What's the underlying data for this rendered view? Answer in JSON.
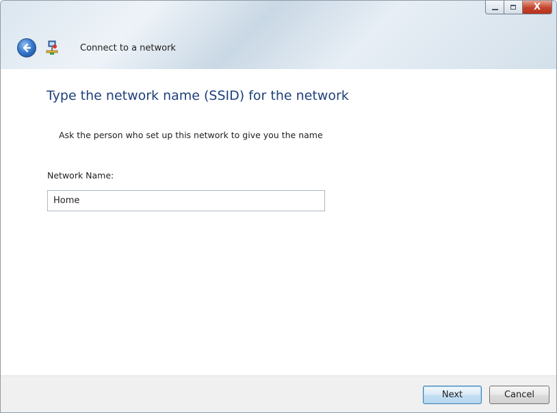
{
  "window": {
    "title": "Connect to a network",
    "controls": {
      "minimize_icon": "minimize-icon",
      "maximize_icon": "maximize-icon",
      "close_icon": "close-icon",
      "close_glyph": "X"
    },
    "back_icon": "back-arrow-icon",
    "app_icon": "network-icon"
  },
  "main": {
    "heading": "Type the network name (SSID) for the network",
    "instruction": "Ask the person who set up this network to give you the name",
    "network_name_label": "Network Name:",
    "network_name_value": "Home"
  },
  "footer": {
    "next_label": "Next",
    "cancel_label": "Cancel"
  },
  "colors": {
    "heading": "#1e3f7a",
    "close_button": "#c4432b",
    "footer_bg": "#f0f0f0"
  }
}
